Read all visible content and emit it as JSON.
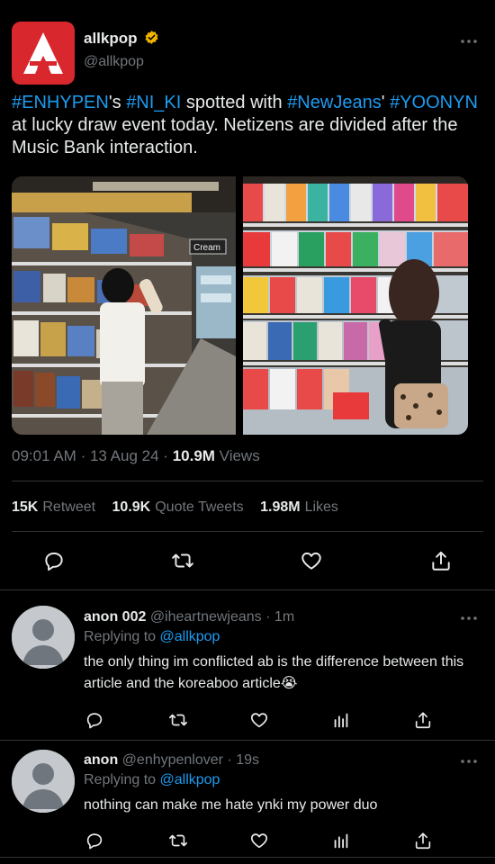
{
  "author": {
    "name": "allkpop",
    "handle": "@allkpop"
  },
  "tweet": {
    "segments": [
      {
        "text": "#ENHYPEN",
        "type": "hashtag"
      },
      {
        "text": "'s ",
        "type": "text"
      },
      {
        "text": "#NI_KI",
        "type": "hashtag"
      },
      {
        "text": " spotted with ",
        "type": "text"
      },
      {
        "text": "#NewJeans",
        "type": "hashtag"
      },
      {
        "text": "' ",
        "type": "text"
      },
      {
        "text": "#YOONYN",
        "type": "hashtag"
      },
      {
        "text": " at lucky draw event today. Netizens are divided after the Music Bank interaction.",
        "type": "text"
      }
    ],
    "time": "09:01 AM",
    "date": "13 Aug 24",
    "views_count": "10.9M",
    "views_label": "Views",
    "photo_sign": "Cream"
  },
  "stats": {
    "retweets_count": "15K",
    "retweets_label": "Retweet",
    "quotes_count": "10.9K",
    "quotes_label": "Quote Tweets",
    "likes_count": "1.98M",
    "likes_label": "Likes"
  },
  "replies": [
    {
      "name": "anon 002",
      "handle": "@iheartnewjeans",
      "age": "1m",
      "replying_label": "Replying to",
      "replying_to": "@allkpop",
      "text": "the only thing im conflicted ab is the difference between this article and the koreaboo article😭"
    },
    {
      "name": "anon",
      "handle": "@enhypenlover",
      "age": "19s",
      "replying_label": "Replying to",
      "replying_to": "@allkpop",
      "text": "nothing can make me hate ynki my power duo"
    }
  ],
  "separators": {
    "dot": "·"
  },
  "colors": {
    "background": "#000000",
    "text": "#e7e9ea",
    "muted": "#71767b",
    "link": "#1d9bf0",
    "brand_red": "#d9272e",
    "verified": "#f2b400"
  }
}
